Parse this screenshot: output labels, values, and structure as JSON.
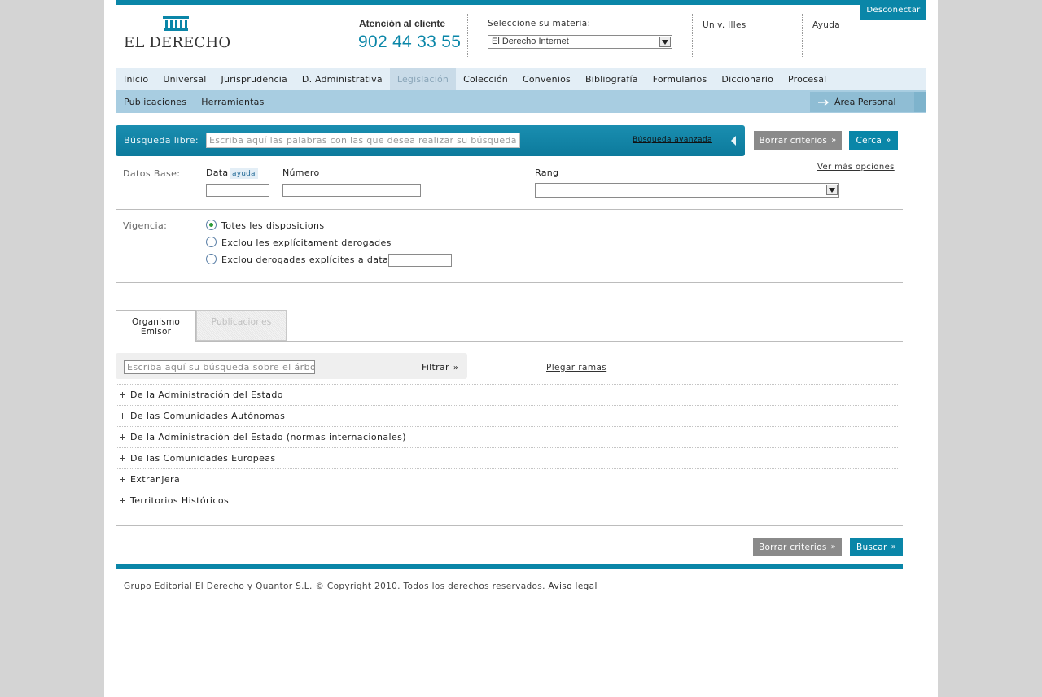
{
  "header": {
    "disconnect_label": "Desconectar",
    "logo_text": "EL DERECHO",
    "customer_label": "Atención al cliente",
    "customer_phone": "902 44 33 55",
    "materia_label": "Seleccione su materia:",
    "materia_value": "El Derecho Internet",
    "univ_label": "Univ. Illes",
    "help_label": "Ayuda"
  },
  "nav": {
    "items": [
      {
        "label": "Inicio",
        "active": false
      },
      {
        "label": "Universal",
        "active": false
      },
      {
        "label": "Jurisprudencia",
        "active": false
      },
      {
        "label": "D. Administrativa",
        "active": false
      },
      {
        "label": "Legislación",
        "active": true
      },
      {
        "label": "Colección",
        "active": false
      },
      {
        "label": "Convenios",
        "active": false
      },
      {
        "label": "Bibliografía",
        "active": false
      },
      {
        "label": "Formularios",
        "active": false
      },
      {
        "label": "Diccionario",
        "active": false
      },
      {
        "label": "Procesal",
        "active": false
      }
    ],
    "sub_items": [
      "Publicaciones",
      "Herramientas"
    ],
    "area_personal": "Área Personal"
  },
  "search": {
    "label": "Búsqueda libre:",
    "placeholder": "Escriba aquí las palabras con las que desea realizar su búsqueda",
    "advanced_link": "Búsqueda avanzada",
    "clear_label": "Borrar criterios",
    "search_label": "Cerca"
  },
  "base": {
    "label": "Datos Base:",
    "date_label": "Data",
    "date_help": "ayuda",
    "number_label": "Número",
    "rank_label": "Rang",
    "more_options": "Ver más opciones"
  },
  "vigencia": {
    "label": "Vigencia:",
    "options": [
      {
        "label": "Totes les disposicions",
        "checked": true
      },
      {
        "label": "Exclou les explícitament derogades",
        "checked": false
      },
      {
        "label": "Exclou derogades explícites a data:",
        "checked": false
      }
    ]
  },
  "tabs": {
    "org_line1": "Organismo",
    "org_line2": "Emisor",
    "pub": "Publicaciones"
  },
  "tree": {
    "filter_placeholder": "Escriba aquí su búsqueda sobre el árbol",
    "filter_label": "Filtrar",
    "collapse_link": "Plegar ramas",
    "items": [
      "De la Administración del Estado",
      "De las Comunidades Autónomas",
      "De la Administración del Estado (normas internacionales)",
      "De las Comunidades Europeas",
      "Extranjera",
      "Territorios Históricos"
    ]
  },
  "bottom": {
    "clear_label": "Borrar criterios",
    "search_label": "Buscar"
  },
  "footer": {
    "copyright": "Grupo Editorial El Derecho y Quantor S.L. © Copyright 2010. Todos los derechos reservados.",
    "legal_link": "Aviso legal"
  },
  "colors": {
    "accent": "#0a86a8",
    "nav_bg": "#e3eef6",
    "subnav_bg": "#a8cde1",
    "grey_button": "#8a8a8a"
  }
}
